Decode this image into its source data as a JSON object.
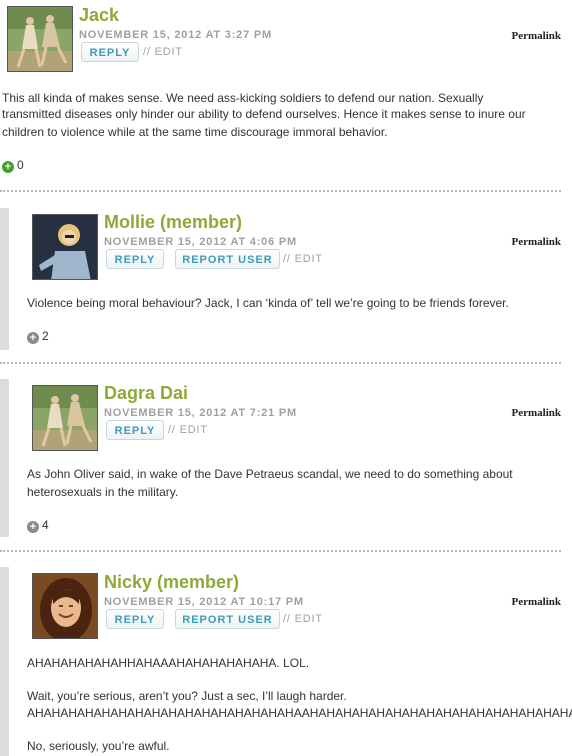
{
  "colors": {
    "author_green": "#8fa83a",
    "button_text_blue": "#3d9ab8",
    "vote_positive_green": "#3ba32a",
    "vote_neutral_gray": "#8a8a8a"
  },
  "comments": [
    {
      "author": "Jack",
      "date": "NOVEMBER 15, 2012 AT 3:27 PM",
      "reply_label": "REPLY",
      "edit_label": "// EDIT",
      "permalink": "Permalink",
      "body": [
        "This all kinda of makes sense. We need ass-kicking soldiers to defend our nation. Sexually",
        "transmitted diseases only hinder our ability to defend ourselves. Hence it makes sense to inure our",
        "children to violence while at the same time discourage immoral behavior."
      ],
      "votes": "0",
      "vote_icon": "plus-circle-green-icon"
    },
    {
      "author": "Mollie (member)",
      "date": "NOVEMBER 15, 2012 AT 4:06 PM",
      "reply_label": "REPLY",
      "report_label": "REPORT USER",
      "edit_label": "// EDIT",
      "permalink": "Permalink",
      "body": [
        "Violence being moral behaviour? Jack, I can ‘kinda of’ tell we’re going to be friends forever."
      ],
      "votes": "2",
      "vote_icon": "plus-circle-gray-icon"
    },
    {
      "author": "Dagra Dai",
      "date": "NOVEMBER 15, 2012 AT 7:21 PM",
      "reply_label": "REPLY",
      "edit_label": "// EDIT",
      "permalink": "Permalink",
      "body": [
        "As John Oliver said, in wake of the Dave Petraeus scandal, we need to do something about",
        "heterosexuals in the military."
      ],
      "votes": "4",
      "vote_icon": "plus-circle-gray-icon"
    },
    {
      "author": "Nicky (member)",
      "date": "NOVEMBER 15, 2012 AT 10:17 PM",
      "reply_label": "REPLY",
      "report_label": "REPORT USER",
      "edit_label": "// EDIT",
      "permalink": "Permalink",
      "body": [
        "AHAHAHAHAHAHHAHAAAHAHAHAHAHAHA. LOL.",
        "Wait, you’re serious, aren’t you? Just a sec, I’ll laugh harder.",
        "AHAHAHAHAHAHAHAHAHAHAHAHAHAHAHAHAAHAHAHAHAHAHAHAHAHAHAHAHAHAHAHAHAHAHAHAHAHAH",
        "No, seriously, you’re awful."
      ]
    }
  ]
}
